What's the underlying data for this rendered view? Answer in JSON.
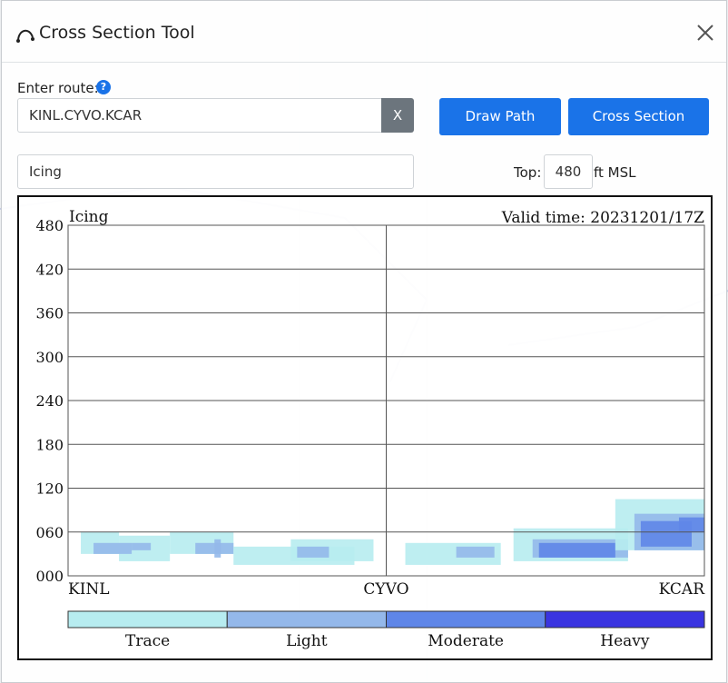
{
  "dialog": {
    "title": "Cross Section Tool",
    "route_label": "Enter route:",
    "help_icon": "?",
    "route_value": "KINL.CYVO.KCAR",
    "clear_label": "X",
    "draw_path_label": "Draw Path",
    "cross_section_label": "Cross Section",
    "product_value": "Icing",
    "top_label": "Top:",
    "top_value": "480",
    "top_unit": "ft MSL",
    "icons": [
      "route-icon",
      "close-icon",
      "help-icon"
    ],
    "accent": "#1a73e8"
  },
  "chart_data": {
    "type": "heatmap",
    "title": "Icing",
    "valid_time": "Valid time: 20231201/17Z",
    "y_ticks": [
      "480",
      "420",
      "360",
      "300",
      "240",
      "180",
      "120",
      "060",
      "000"
    ],
    "y_values": [
      480,
      420,
      360,
      300,
      240,
      180,
      120,
      60,
      0
    ],
    "ylim": [
      0,
      480
    ],
    "x_stations": [
      "KINL",
      "CYVO",
      "KCAR"
    ],
    "grid": true,
    "legend": {
      "items": [
        {
          "label": "Trace",
          "color": "#b7ecf0"
        },
        {
          "label": "Light",
          "color": "#94b8ea"
        },
        {
          "label": "Moderate",
          "color": "#5f86e8"
        },
        {
          "label": "Heavy",
          "color": "#3a34e0"
        }
      ]
    },
    "cells": [
      {
        "x0": 0.02,
        "x1": 0.08,
        "y0": 30,
        "y1": 60,
        "level": "Trace"
      },
      {
        "x0": 0.08,
        "x1": 0.16,
        "y0": 20,
        "y1": 55,
        "level": "Trace"
      },
      {
        "x0": 0.04,
        "x1": 0.1,
        "y0": 30,
        "y1": 45,
        "level": "Light"
      },
      {
        "x0": 0.1,
        "x1": 0.13,
        "y0": 35,
        "y1": 45,
        "level": "Light"
      },
      {
        "x0": 0.16,
        "x1": 0.26,
        "y0": 30,
        "y1": 60,
        "level": "Trace"
      },
      {
        "x0": 0.2,
        "x1": 0.26,
        "y0": 30,
        "y1": 45,
        "level": "Light"
      },
      {
        "x0": 0.23,
        "x1": 0.24,
        "y0": 25,
        "y1": 50,
        "level": "Light"
      },
      {
        "x0": 0.26,
        "x1": 0.45,
        "y0": 15,
        "y1": 40,
        "level": "Trace"
      },
      {
        "x0": 0.35,
        "x1": 0.48,
        "y0": 20,
        "y1": 50,
        "level": "Trace"
      },
      {
        "x0": 0.36,
        "x1": 0.41,
        "y0": 25,
        "y1": 40,
        "level": "Light"
      },
      {
        "x0": 0.53,
        "x1": 0.68,
        "y0": 15,
        "y1": 45,
        "level": "Trace"
      },
      {
        "x0": 0.61,
        "x1": 0.67,
        "y0": 25,
        "y1": 40,
        "level": "Light"
      },
      {
        "x0": 0.7,
        "x1": 0.88,
        "y0": 20,
        "y1": 65,
        "level": "Trace"
      },
      {
        "x0": 0.73,
        "x1": 0.88,
        "y0": 25,
        "y1": 50,
        "level": "Light"
      },
      {
        "x0": 0.74,
        "x1": 0.86,
        "y0": 25,
        "y1": 45,
        "level": "Moderate"
      },
      {
        "x0": 0.86,
        "x1": 1.0,
        "y0": 35,
        "y1": 105,
        "level": "Trace"
      },
      {
        "x0": 0.89,
        "x1": 1.0,
        "y0": 35,
        "y1": 85,
        "level": "Light"
      },
      {
        "x0": 0.9,
        "x1": 0.98,
        "y0": 40,
        "y1": 75,
        "level": "Moderate"
      },
      {
        "x0": 0.96,
        "x1": 1.0,
        "y0": 60,
        "y1": 80,
        "level": "Moderate"
      }
    ]
  }
}
